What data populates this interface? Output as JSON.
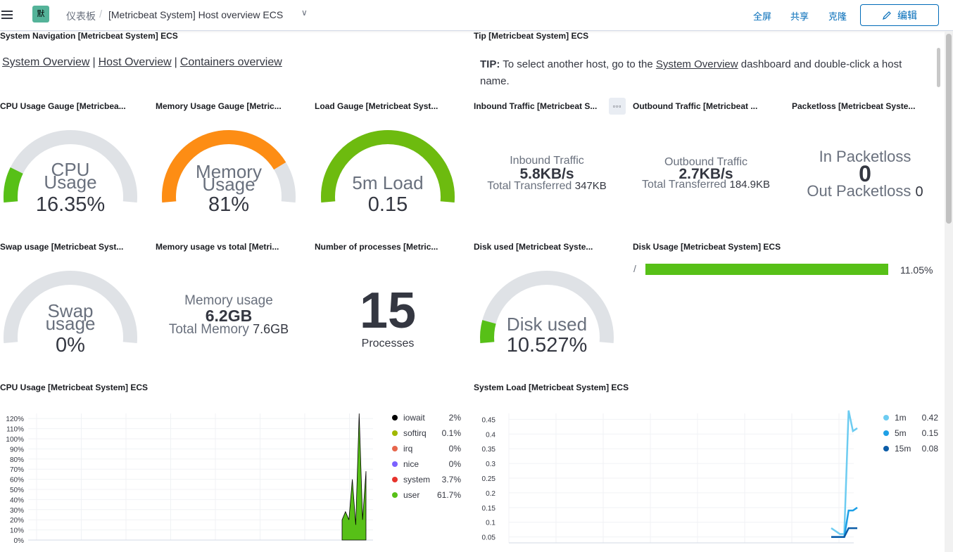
{
  "header": {
    "space_initial": "默",
    "breadcrumb_root": "仪表板",
    "breadcrumb_current": "[Metricbeat System] Host overview ECS",
    "fullscreen": "全屏",
    "share": "共享",
    "clone": "克隆",
    "edit": "编辑"
  },
  "panels": {
    "nav_title": "System Navigation [Metricbeat System] ECS",
    "nav_links": [
      "System Overview",
      "Host Overview",
      "Containers overview"
    ],
    "tip_title": "Tip [Metricbeat System] ECS",
    "tip_label": "TIP:",
    "tip_text_before": "To select another host, go to the",
    "tip_link": "System Overview",
    "tip_text_after": "dashboard and double-click a host name.",
    "cpu_gauge_title": "CPU Usage Gauge [Metricbea...",
    "mem_gauge_title": "Memory Usage Gauge [Metric...",
    "load_gauge_title": "Load Gauge [Metricbeat Syst...",
    "inbound_title": "Inbound Traffic [Metricbeat S...",
    "outbound_title": "Outbound Traffic [Metricbeat ...",
    "packetloss_title": "Packetloss [Metricbeat Syste...",
    "swap_title": "Swap usage [Metricbeat Syst...",
    "mem_total_title": "Memory usage vs total [Metri...",
    "processes_title": "Number of processes [Metric...",
    "disk_used_title": "Disk used [Metricbeat Syste...",
    "disk_usage_title": "Disk Usage [Metricbeat System] ECS",
    "cpu_usage_title": "CPU Usage [Metricbeat System] ECS",
    "system_load_title": "System Load [Metricbeat System] ECS"
  },
  "gauges": {
    "cpu": {
      "label1": "CPU",
      "label2": "Usage",
      "value": "16.35%",
      "fraction": 0.1635,
      "color": "#57c017"
    },
    "memory": {
      "label1": "Memory",
      "label2": "Usage",
      "value": "81%",
      "fraction": 0.81,
      "color": "#fd8d14"
    },
    "load": {
      "label1": "5m Load",
      "value": "0.15",
      "fraction": 1.0,
      "color": "#6dbb0f"
    },
    "swap": {
      "label1": "Swap",
      "label2": "usage",
      "value": "0%",
      "fraction": 0.0,
      "color": "#57c017"
    },
    "disk": {
      "label1": "Disk used",
      "value": "10.527%",
      "fraction": 0.10527,
      "color": "#57c017"
    }
  },
  "metrics": {
    "inbound": {
      "label": "Inbound Traffic",
      "value": "5.8KB/s",
      "sub_label": "Total Transferred",
      "sub_value": "347KB"
    },
    "outbound": {
      "label": "Outbound Traffic",
      "value": "2.7KB/s",
      "sub_label": "Total Transferred",
      "sub_value": "184.9KB"
    },
    "packetloss": {
      "label_in": "In Packetloss",
      "value_in": "0",
      "label_out": "Out Packetloss",
      "value_out": "0"
    },
    "memory_total": {
      "label": "Memory usage",
      "value": "6.2GB",
      "sub_label": "Total Memory",
      "sub_value": "7.6GB"
    },
    "processes": {
      "value": "15",
      "label": "Processes"
    }
  },
  "disk_usage": {
    "mount": "/",
    "percent_label": "11.05%",
    "fraction": 0.1105,
    "color": "#57c017"
  },
  "chart_data": [
    {
      "type": "area",
      "title": "CPU Usage [Metricbeat System] ECS",
      "y_ticks": [
        "120%",
        "110%",
        "100%",
        "90%",
        "80%",
        "70%",
        "60%",
        "50%",
        "40%",
        "30%",
        "20%",
        "10%",
        "0%"
      ],
      "ylim": [
        0,
        125
      ],
      "y_values": [
        0,
        0,
        0,
        0,
        0,
        0,
        0,
        0,
        0,
        0,
        0,
        0,
        20,
        28,
        20,
        60,
        15,
        125,
        20,
        68
      ],
      "series": [
        {
          "name": "iowait",
          "value": "2%",
          "color": "#000000"
        },
        {
          "name": "softirq",
          "value": "0.1%",
          "color": "#a1b800"
        },
        {
          "name": "irq",
          "value": "0%",
          "color": "#e7664c"
        },
        {
          "name": "nice",
          "value": "0%",
          "color": "#7b61ff"
        },
        {
          "name": "system",
          "value": "3.7%",
          "color": "#e7332c"
        },
        {
          "name": "user",
          "value": "61.7%",
          "color": "#57c017"
        }
      ]
    },
    {
      "type": "line",
      "title": "System Load [Metricbeat System] ECS",
      "y_ticks": [
        "0.45",
        "0.4",
        "0.35",
        "0.3",
        "0.25",
        "0.2",
        "0.15",
        "0.1",
        "0.05"
      ],
      "ylim": [
        0.03,
        0.47
      ],
      "series": [
        {
          "name": "1m",
          "value": "0.42",
          "color": "#6dccf1",
          "points": [
            0.08,
            0.07,
            0.06,
            0.06,
            0.48,
            0.41,
            0.42
          ]
        },
        {
          "name": "5m",
          "value": "0.15",
          "color": "#1ea0e6",
          "points": [
            0.05,
            0.05,
            0.05,
            0.05,
            0.14,
            0.14,
            0.15
          ]
        },
        {
          "name": "15m",
          "value": "0.08",
          "color": "#0b5ca7",
          "points": [
            0.05,
            0.05,
            0.05,
            0.05,
            0.08,
            0.08,
            0.08
          ]
        }
      ]
    }
  ]
}
